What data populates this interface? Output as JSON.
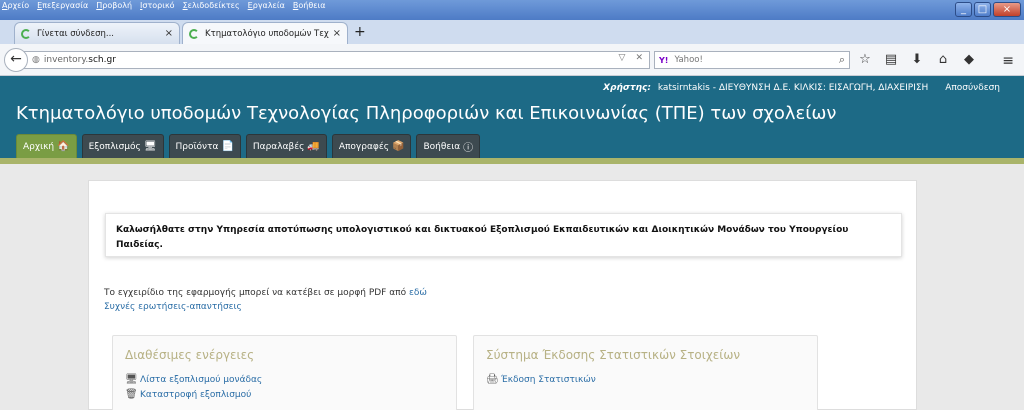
{
  "browser": {
    "menu": [
      "Αρχείο",
      "Επεξεργασία",
      "Προβολή",
      "Ιστορικό",
      "Σελιδοδείκτες",
      "Εργαλεία",
      "Βοήθεια"
    ],
    "tabs": [
      {
        "label": "Γίνεται σύνδεση...",
        "close": "×"
      },
      {
        "label": "Κτηματολόγιο υποδομών Τεχ...",
        "close": "×"
      }
    ],
    "new_tab": "+",
    "url_prefix": "inventory.",
    "url_domain": "sch.gr",
    "search_engine": "Y!",
    "search_placeholder": "Yahoo!",
    "window_buttons": {
      "min": "_",
      "max": "□",
      "close": "×"
    }
  },
  "header": {
    "user_label": "Χρήστης:",
    "user_value": "katsirntakis - ΔΙΕΥΘΥΝΣΗ Δ.Ε. ΚΙΛΚΙΣ: ΕΙΣΑΓΩΓΗ, ΔΙΑΧΕΙΡΙΣΗ",
    "logout": "Αποσύνδεση",
    "title": "Κτηματολόγιο υποδομών Τεχνολογίας Πληροφοριών και Επικοινωνίας (ΤΠΕ) των σχολείων",
    "nav": [
      {
        "label": "Αρχική",
        "icon": "home-icon",
        "active": true
      },
      {
        "label": "Εξοπλισμός",
        "icon": "computer-icon",
        "active": false
      },
      {
        "label": "Προϊόντα",
        "icon": "document-icon",
        "active": false
      },
      {
        "label": "Παραλαβές",
        "icon": "truck-icon",
        "active": false
      },
      {
        "label": "Απογραφές",
        "icon": "box-icon",
        "active": false
      },
      {
        "label": "Βοήθεια",
        "icon": "help-icon",
        "active": false
      }
    ]
  },
  "content": {
    "welcome": "Καλωσήλθατε στην Υπηρεσία αποτύπωσης υπολογιστικού και δικτυακού Εξοπλισμού Εκπαιδευτικών και Διοικητικών Μονάδων του Υπουργείου Παιδείας.",
    "manual_text": "Το εγχειρίδιο της εφαρμογής μπορεί να κατέβει σε μορφή PDF από",
    "manual_link": "εδώ",
    "faq": "Συχνές ερωτήσεις-απαντήσεις",
    "actions_title": "Διαθέσιμες ενέργειες",
    "actions": [
      {
        "label": "Λίστα εξοπλισμού μονάδας",
        "icon": "computer-icon"
      },
      {
        "label": "Καταστροφή εξοπλισμού",
        "icon": "trash-icon"
      }
    ],
    "stats_title": "Σύστημα Έκδοσης Στατιστικών Στοιχείων",
    "stats": [
      {
        "label": "Έκδοση Στατιστικών",
        "icon": "print-icon"
      }
    ]
  },
  "colors": {
    "header": "#1d6a86",
    "active_tab": "#7a9d44",
    "link": "#2a6da6"
  }
}
